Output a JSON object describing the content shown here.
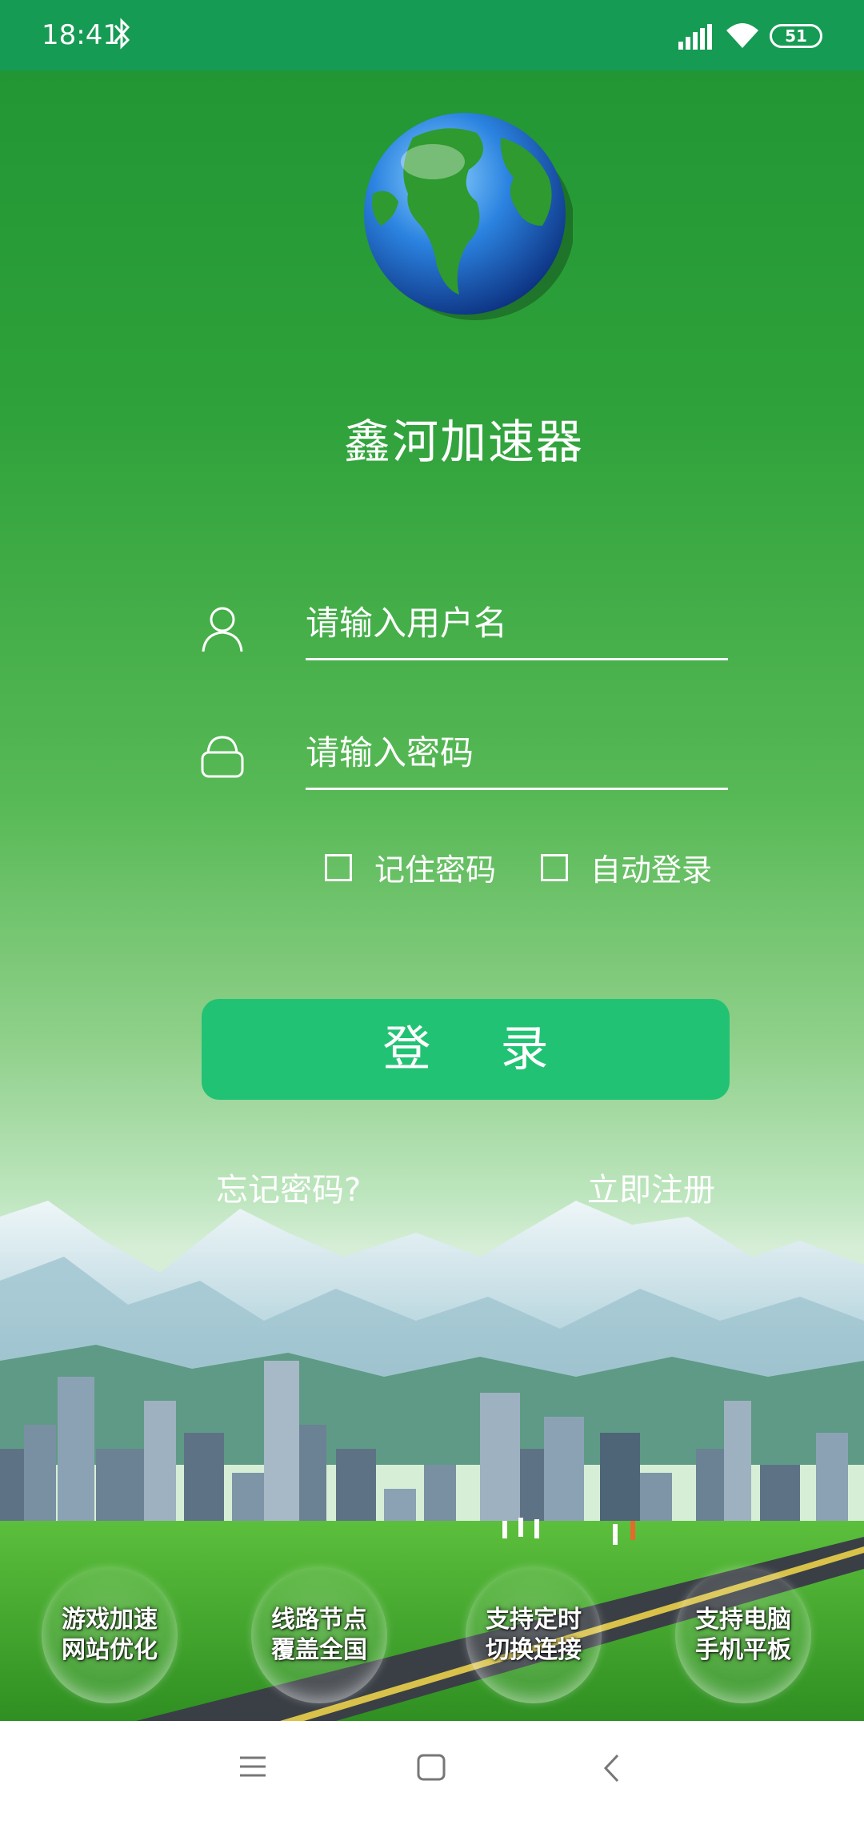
{
  "status_bar": {
    "time": "18:41",
    "battery": "51",
    "icons": [
      "bluetooth-icon",
      "signal-icon",
      "wifi-icon",
      "battery-icon"
    ]
  },
  "app": {
    "title": "鑫河加速器",
    "logo_icon": "globe-icon"
  },
  "login": {
    "username_placeholder": "请输入用户名",
    "password_placeholder": "请输入密码",
    "remember_label": "记住密码",
    "autologin_label": "自动登录",
    "login_button": "登 录",
    "forgot_link": "忘记密码?",
    "register_link": "立即注册"
  },
  "features": [
    {
      "line1": "游戏加速",
      "line2": "网站优化"
    },
    {
      "line1": "线路节点",
      "line2": "覆盖全国"
    },
    {
      "line1": "支持定时",
      "line2": "切换连接"
    },
    {
      "line1": "支持电脑",
      "line2": "手机平板"
    }
  ],
  "nav_bar": {
    "buttons": [
      "menu-icon",
      "home-icon",
      "back-icon"
    ]
  },
  "colors": {
    "status_bar": "#169b54",
    "background_top": "#1f9432",
    "button": "#22c274",
    "nav_bar": "#ffffff"
  }
}
